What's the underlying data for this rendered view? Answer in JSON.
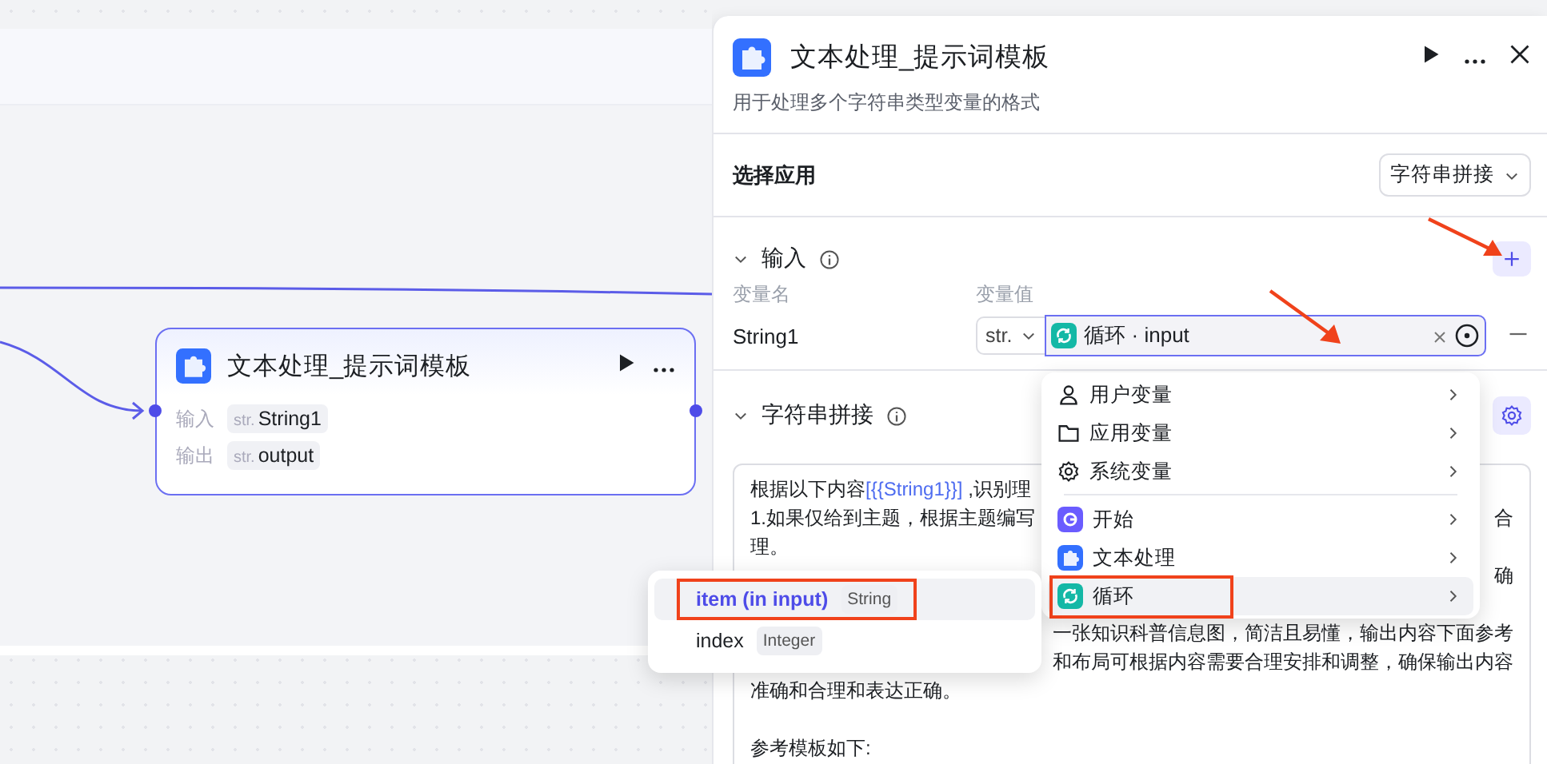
{
  "canvas": {
    "node": {
      "title": "文本处理_提示词模板",
      "selected": true,
      "ports": [
        {
          "label": "输入",
          "type": "str.",
          "name": "String1"
        },
        {
          "label": "输出",
          "type": "str.",
          "name": "output"
        }
      ]
    }
  },
  "panel": {
    "title": "文本处理_提示词模板",
    "description": "用于处理多个字符串类型变量的格式",
    "app_select": {
      "label": "选择应用",
      "value": "字符串拼接"
    },
    "input_section": {
      "title": "输入",
      "expanded": true,
      "columns": [
        "变量名",
        "变量值"
      ],
      "variables": [
        {
          "name": "String1",
          "type": "str.",
          "value": "循环 · input",
          "focused": true
        }
      ]
    },
    "template_section": {
      "title": "字符串拼接",
      "expanded": true,
      "lines": [
        {
          "left": [
            {
              "kind": "text",
              "text": "根据以下内容"
            },
            {
              "kind": "variable",
              "text": "[{{String1}}]"
            },
            {
              "kind": "text",
              "text": " ,识别理"
            }
          ]
        },
        {
          "left": [
            {
              "kind": "text",
              "text": "1.如果仅给到主题，根据主题编写"
            }
          ],
          "right": "合"
        },
        {
          "left": [
            {
              "kind": "text",
              "text": "理。"
            }
          ]
        },
        {
          "right": "确"
        },
        {
          "gap_before": true,
          "right": "一张知识科普信息图，简洁且易懂，输出内容下面参考"
        },
        {
          "right": "和布局可根据内容需要合理安排和调整，确保输出内容"
        },
        {
          "left": [
            {
              "kind": "text",
              "text": "准确和合理和表达正确。"
            }
          ]
        },
        {
          "gap_before": true,
          "left": [
            {
              "kind": "text",
              "text": "参考模板如下:"
            }
          ]
        }
      ]
    }
  },
  "variable_menu": {
    "sections": [
      {
        "items": [
          {
            "label": "用户变量",
            "kind": "user",
            "selected": false,
            "annotated": false
          },
          {
            "label": "应用变量",
            "kind": "folder",
            "selected": false,
            "annotated": false
          },
          {
            "label": "系统变量",
            "kind": "gear",
            "selected": false,
            "annotated": false
          }
        ]
      },
      {
        "items": [
          {
            "label": "开始",
            "kind": "start",
            "selected": false,
            "annotated": false
          },
          {
            "label": "文本处理",
            "kind": "text",
            "selected": false,
            "annotated": false
          },
          {
            "label": "循环",
            "kind": "loop",
            "selected": true,
            "annotated": true
          }
        ]
      }
    ]
  },
  "submenu": {
    "items": [
      {
        "name": "item (in input)",
        "type": "String",
        "selected": true,
        "annotated": true
      },
      {
        "name": "index",
        "type": "Integer",
        "selected": false,
        "annotated": false
      }
    ]
  }
}
